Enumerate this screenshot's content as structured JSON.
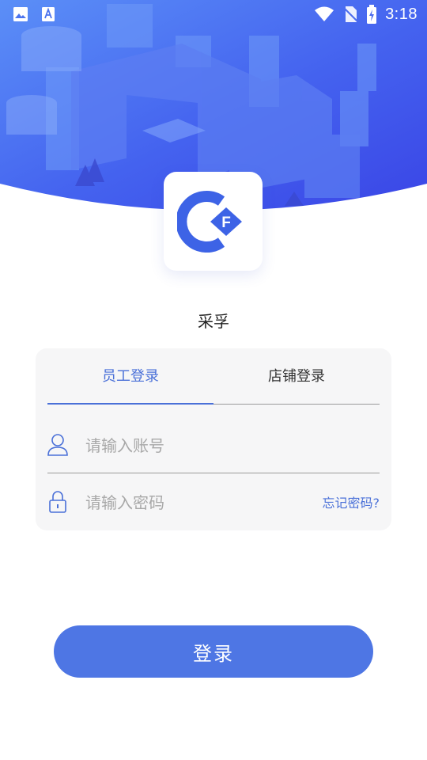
{
  "status_bar": {
    "time": "3:18",
    "icons": [
      "image-icon",
      "text-icon",
      "wifi-icon",
      "no-sim-icon",
      "battery-charging-icon"
    ]
  },
  "app": {
    "name": "采孚",
    "logo_letter": "F",
    "brand_color": "#3d63e6"
  },
  "tabs": [
    {
      "label": "员工登录",
      "active": true
    },
    {
      "label": "店铺登录",
      "active": false
    }
  ],
  "form": {
    "account_placeholder": "请输入账号",
    "account_value": "",
    "password_placeholder": "请输入密码",
    "password_value": "",
    "forgot_label": "忘记密码?"
  },
  "login_button": {
    "label": "登录"
  },
  "colors": {
    "accent": "#4a70d8",
    "button": "#4e76e4",
    "hero_gradient_start": "#4b86f6",
    "hero_gradient_end": "#3b4bea"
  }
}
